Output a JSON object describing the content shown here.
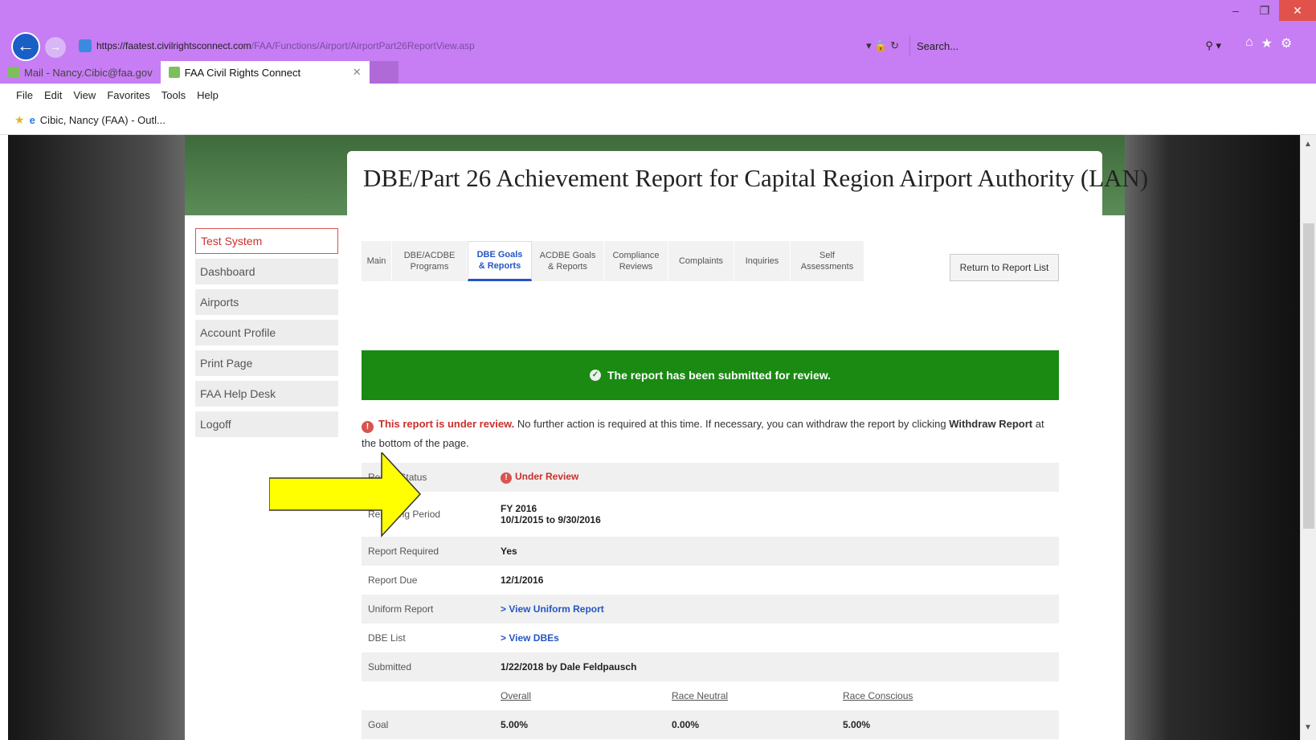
{
  "browser": {
    "url_prefix": "https://",
    "url_host": "faatest.civilrightsconnect.com",
    "url_path": "/FAA/Functions/Airport/AirportPart26ReportView.asp",
    "search_placeholder": "Search...",
    "tabs": [
      {
        "label": "Mail - Nancy.Cibic@faa.gov"
      },
      {
        "label": "FAA Civil Rights Connect"
      }
    ],
    "menu": [
      "File",
      "Edit",
      "View",
      "Favorites",
      "Tools",
      "Help"
    ],
    "favorite": "Cibic, Nancy (FAA) - Outl..."
  },
  "sidebar": {
    "items": [
      "Test System",
      "Dashboard",
      "Airports",
      "Account Profile",
      "Print Page",
      "FAA Help Desk",
      "Logoff"
    ]
  },
  "page": {
    "title": "DBE/Part 26 Achievement Report for Capital Region Airport Authority (LAN)",
    "tabs": [
      {
        "label": "Main"
      },
      {
        "label": "DBE/ACDBE Programs"
      },
      {
        "label": "DBE Goals & Reports"
      },
      {
        "label": "ACDBE Goals & Reports"
      },
      {
        "label": "Compliance Reviews"
      },
      {
        "label": "Complaints"
      },
      {
        "label": "Inquiries"
      },
      {
        "label": "Self Assessments"
      }
    ],
    "return_button": "Return to Report List",
    "success_message": "The report has been submitted for review.",
    "review_bold": "This report is under review.",
    "review_text": " No further action is required at this time. If necessary, you can withdraw the report by clicking ",
    "review_link": "Withdraw Report",
    "review_end": " at the bottom of the page.",
    "rows": {
      "status_label": "Report Status",
      "status_value": "Under Review",
      "period_label": "Reporting Period",
      "period_fy": "FY 2016",
      "period_range": "10/1/2015 to 9/30/2016",
      "required_label": "Report Required",
      "required_value": "Yes",
      "due_label": "Report Due",
      "due_value": "12/1/2016",
      "uniform_label": "Uniform Report",
      "uniform_value": "> View Uniform Report",
      "dbe_label": "DBE List",
      "dbe_value": "> View DBEs",
      "submitted_label": "Submitted",
      "submitted_value": "1/22/2018 by Dale Feldpausch",
      "goal_label": "Goal",
      "col_overall": "Overall",
      "col_race_neutral": "Race Neutral",
      "col_race_conscious": "Race Conscious",
      "goal_overall": "5.00%",
      "goal_neutral": "0.00%",
      "goal_conscious": "5.00%"
    }
  }
}
